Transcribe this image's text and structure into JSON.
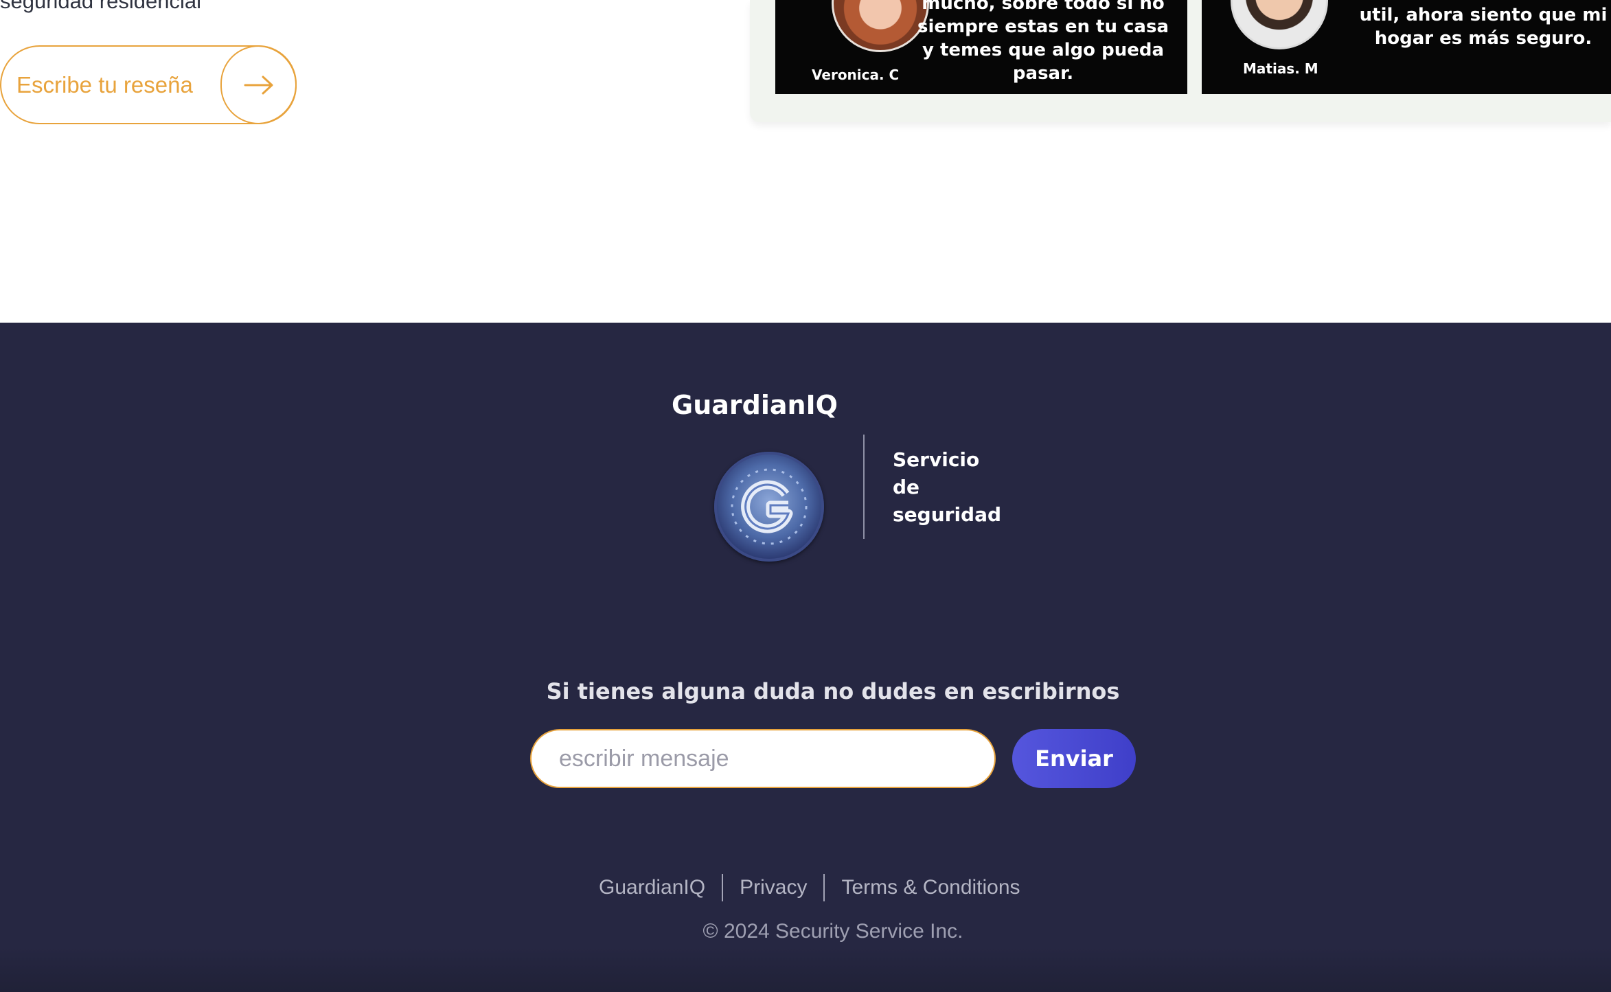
{
  "top": {
    "tagline": "seguridad residencial",
    "review_button_label": "Escribe tu reseña",
    "review_button_icon": "arrow-right-icon"
  },
  "testimonials": [
    {
      "author": "Veronica. C",
      "quote": "mucho, sobre todo si no siempre estas en tu casa y temes que algo pueda pasar."
    },
    {
      "author": "Matias. M",
      "quote": "util, ahora siento que mi hogar es más seguro."
    }
  ],
  "footer": {
    "brand": "GuardianIQ",
    "logo_icon": "guardianiq-logo-icon",
    "logo_tagline": [
      "Servicio",
      "de",
      "seguridad"
    ],
    "contact_heading": "Si tienes alguna duda no dudes en escribirnos",
    "message_placeholder": "escribir mensaje",
    "send_label": "Enviar",
    "links": [
      "GuardianIQ",
      "Privacy",
      "Terms & Conditions"
    ],
    "copyright": "© 2024 Security Service Inc."
  },
  "colors": {
    "accent_orange": "#e8a33c",
    "footer_bg": "#262742",
    "send_button": "#4a4ad6",
    "testimonial_bg": "#060606"
  }
}
